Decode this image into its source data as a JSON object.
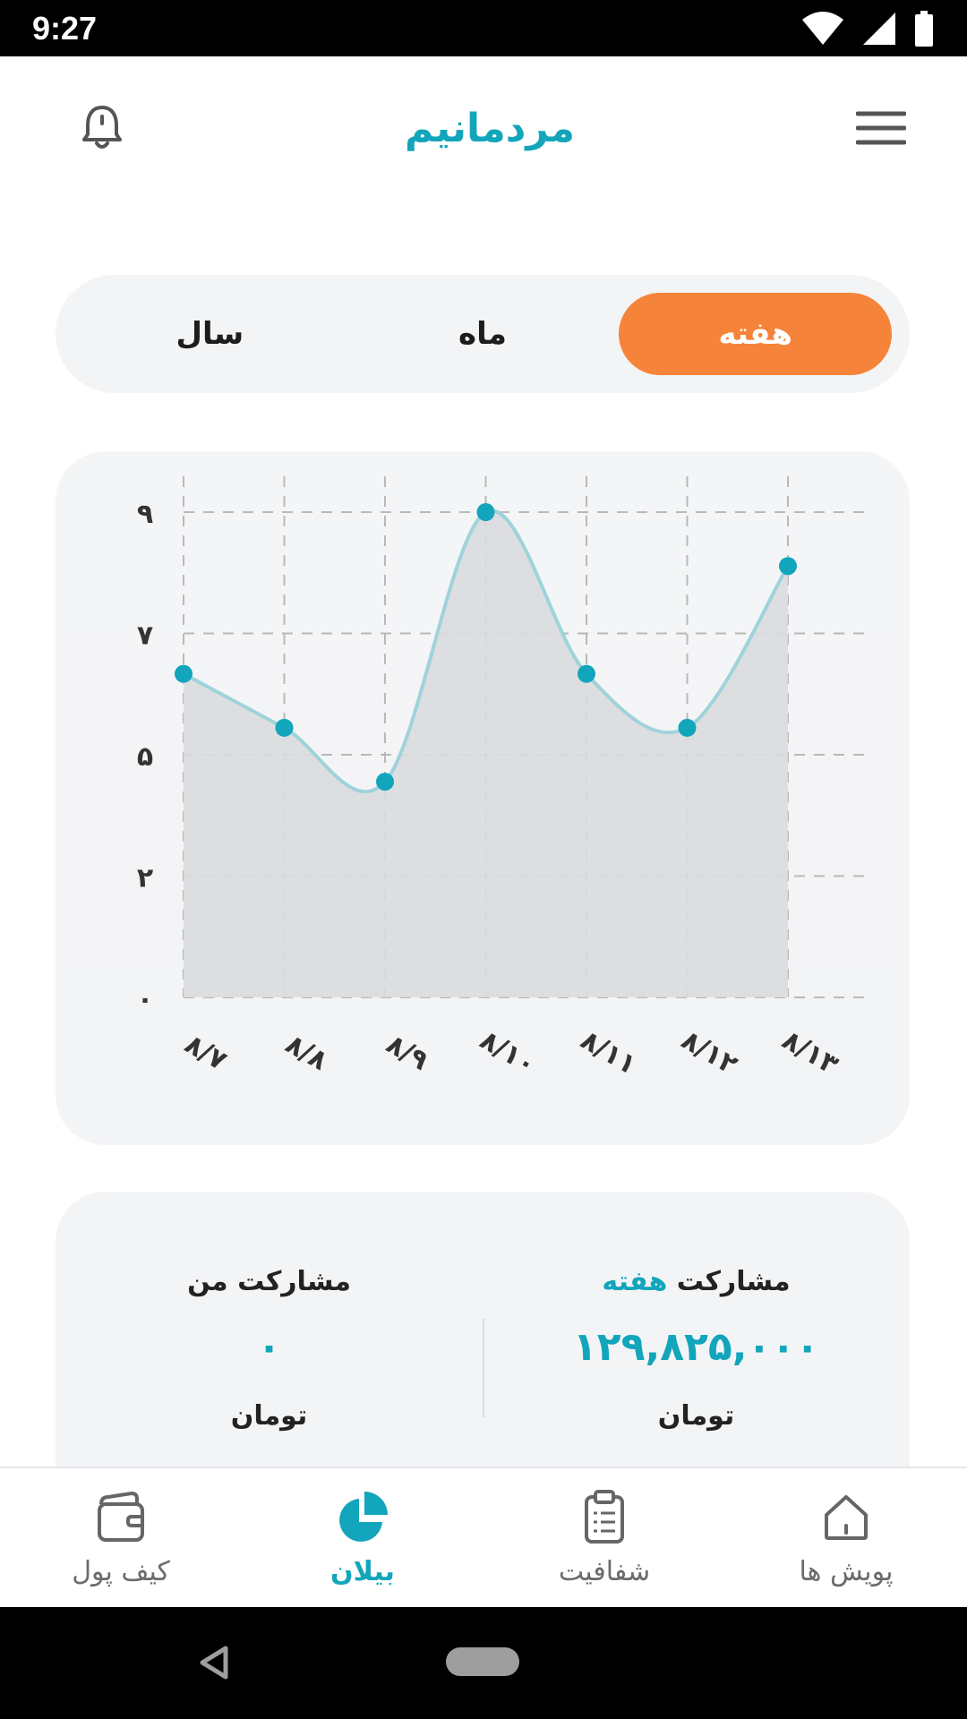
{
  "status_bar": {
    "time": "9:27"
  },
  "header": {
    "logo_text": "مردمانیم",
    "menu_icon": "hamburger-menu-icon",
    "notification_icon": "bell-icon"
  },
  "period_toggle": {
    "tabs": [
      {
        "label": "هفته",
        "active": true
      },
      {
        "label": "ماه",
        "active": false
      },
      {
        "label": "سال",
        "active": false
      }
    ]
  },
  "chart_data": {
    "type": "area",
    "categories": [
      "۸/۷",
      "۸/۸",
      "۸/۹",
      "۸/۱۰",
      "۸/۱۱",
      "۸/۱۲",
      "۸/۱۳"
    ],
    "values": [
      6.0,
      5.0,
      4.0,
      9.0,
      6.0,
      5.0,
      8.0
    ],
    "y_ticks": [
      {
        "value": 0,
        "label": "۰"
      },
      {
        "value": 2.25,
        "label": "۲"
      },
      {
        "value": 4.5,
        "label": "۵"
      },
      {
        "value": 6.75,
        "label": "۷"
      },
      {
        "value": 9,
        "label": "۹"
      }
    ],
    "ylim": [
      0,
      9
    ],
    "grid": true,
    "line_color": "#12a5bb",
    "fill_color": "#dadbde"
  },
  "stats": {
    "weekly": {
      "title_prefix": "مشارکت",
      "title_accent": "هفته",
      "value": "۱۲۹,۸۲۵,۰۰۰",
      "unit": "تومان"
    },
    "mine": {
      "title": "مشارکت من",
      "value": "۰",
      "unit": "تومان"
    }
  },
  "bottom_nav": {
    "items": [
      {
        "label": "پویش ها",
        "icon": "home-icon",
        "active": false
      },
      {
        "label": "شفافیت",
        "icon": "clipboard-icon",
        "active": false
      },
      {
        "label": "بیلان",
        "icon": "pie-chart-icon",
        "active": true
      },
      {
        "label": "کیف پول",
        "icon": "wallet-icon",
        "active": false
      }
    ]
  },
  "colors": {
    "accent": "#12a5bb",
    "orange": "#f5843a"
  }
}
